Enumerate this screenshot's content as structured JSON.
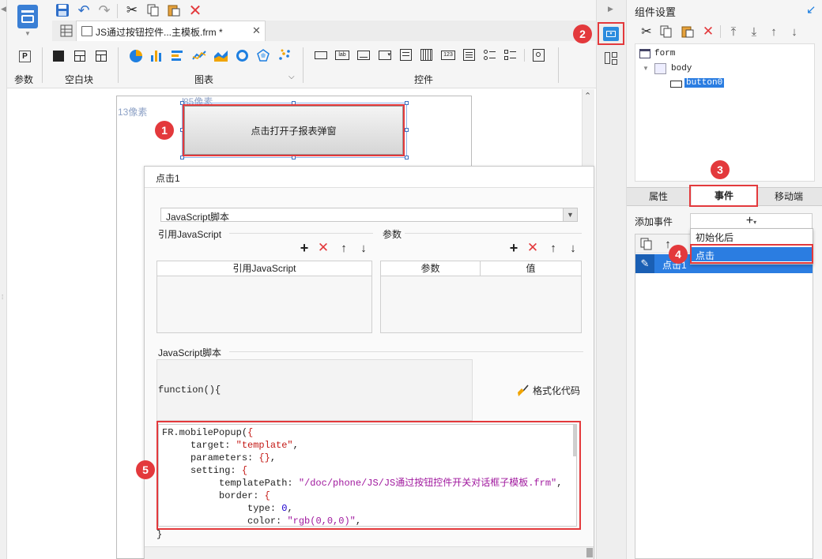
{
  "tab": {
    "title": "JS通过按钮控件...主模板.frm *"
  },
  "ribbon": {
    "param_label": "参数",
    "block_label": "空白块",
    "chart_label": "图表",
    "widget_label": "控件"
  },
  "canvas": {
    "ruler_left": "13像素",
    "ruler_top": "85像素",
    "button_text": "点击打开子报表弹窗"
  },
  "dialog": {
    "title": "点击1",
    "type_value": "JavaScript脚本",
    "ref_js_label": "引用JavaScript",
    "params_label": "参数",
    "ref_js_col": "引用JavaScript",
    "param_col": "参数",
    "value_col": "值",
    "script_label": "JavaScript脚本",
    "func_header": "function(){",
    "format_code": "格式化代码",
    "closing": "}",
    "code_lines": [
      "FR.mobilePopup({",
      "     target: \"template\",",
      "     parameters: {},",
      "     setting: {",
      "          templatePath: \"/doc/phone/JS/JS通过按钮控件开关对话框子模板.frm\",",
      "          border: {",
      "               type: 0,",
      "               color: \"rgb(0,0,0)\","
    ]
  },
  "right": {
    "title": "组件设置",
    "tree": {
      "form": "form",
      "body": "body",
      "button": "button0"
    },
    "tabs": {
      "props": "属性",
      "events": "事件",
      "mobile": "移动端"
    },
    "add_event_label": "添加事件",
    "menu": {
      "item1": "初始化后",
      "item2": "点击"
    },
    "event_row": "点击1"
  },
  "badges": [
    "1",
    "2",
    "3",
    "4",
    "5"
  ],
  "colors": {
    "accent": "#1e7fe0",
    "red": "#e3393c",
    "select": "#2b7de1"
  }
}
